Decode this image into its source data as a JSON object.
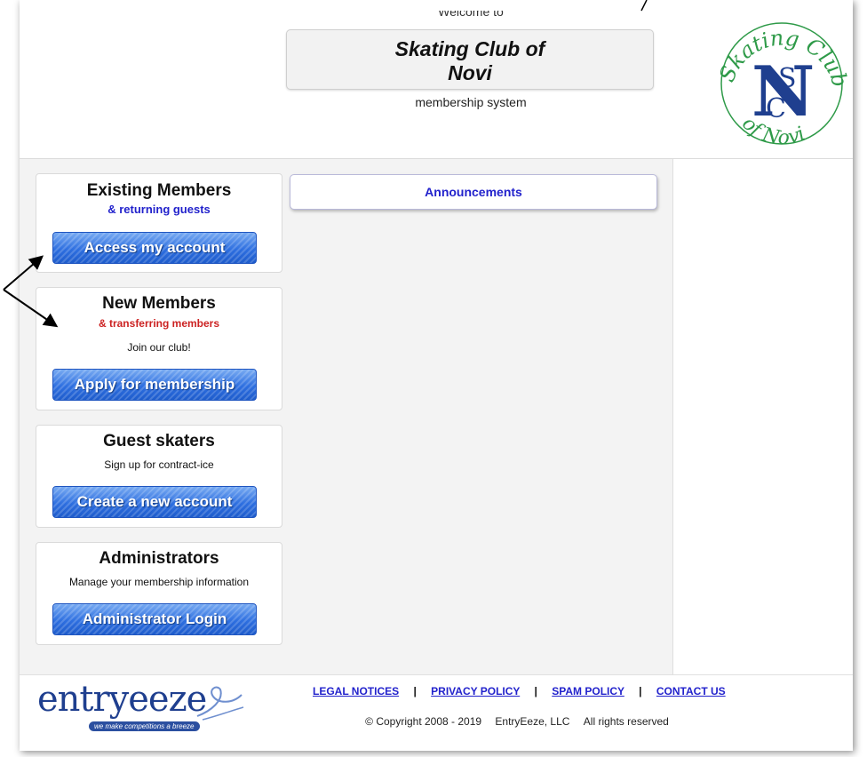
{
  "header": {
    "welcome": "Welcome to",
    "club_name_line1": "Skating Club of",
    "club_name_line2": "Novi",
    "subtitle": "membership system",
    "logo": {
      "ring_top": "Skating Club",
      "ring_bottom": "of Novi",
      "monogram": "NSCC"
    }
  },
  "cards": {
    "existing": {
      "title": "Existing Members",
      "subtitle": "& returning guests",
      "button": "Access my account"
    },
    "new": {
      "title": "New Members",
      "subtitle": "& transferring members",
      "note": "Join our club!",
      "button": "Apply for membership"
    },
    "guest": {
      "title": "Guest skaters",
      "note": "Sign up for contract-ice",
      "button": "Create a new account"
    },
    "admin": {
      "title": "Administrators",
      "note": "Manage your membership information",
      "button": "Administrator Login"
    }
  },
  "announcements": {
    "label": "Announcements"
  },
  "footer": {
    "logo_word": "entryeeze",
    "logo_tagline": "we make competitions a breeze",
    "links": [
      "LEGAL NOTICES",
      "PRIVACY POLICY",
      "SPAM POLICY",
      "CONTACT US"
    ],
    "separator": "|",
    "copyright": "© Copyright 2008 - 2019",
    "company": "EntryEeze, LLC",
    "rights": "All rights reserved"
  },
  "colors": {
    "accent_blue": "#2222cc",
    "accent_red": "#cc2222",
    "button_blue": "#2e6fe0",
    "logo_navy": "#1f3f8f",
    "logo_green": "#2e9a48"
  }
}
